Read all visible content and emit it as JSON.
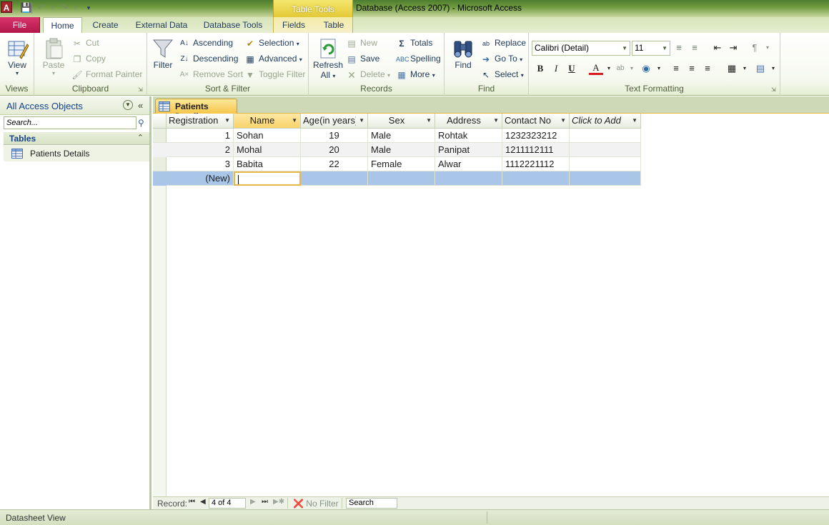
{
  "window": {
    "title": "Database1 : Database (Access 2007)  -  Microsoft Access",
    "contextual_header": "Table Tools"
  },
  "tabs": {
    "file": "File",
    "home": "Home",
    "create": "Create",
    "external_data": "External Data",
    "database_tools": "Database Tools",
    "fields": "Fields",
    "table": "Table"
  },
  "ribbon": {
    "views": {
      "label": "Views",
      "view": "View"
    },
    "clipboard": {
      "label": "Clipboard",
      "paste": "Paste",
      "cut": "Cut",
      "copy": "Copy",
      "format_painter": "Format Painter"
    },
    "sort_filter": {
      "label": "Sort & Filter",
      "filter": "Filter",
      "ascending": "Ascending",
      "descending": "Descending",
      "remove_sort": "Remove Sort",
      "selection": "Selection",
      "advanced": "Advanced",
      "toggle_filter": "Toggle Filter"
    },
    "records": {
      "label": "Records",
      "refresh": "Refresh",
      "refresh_all": "All",
      "new": "New",
      "save": "Save",
      "delete": "Delete",
      "totals": "Totals",
      "spelling": "Spelling",
      "more": "More"
    },
    "find": {
      "label": "Find",
      "find": "Find",
      "replace": "Replace",
      "goto": "Go To",
      "select": "Select"
    },
    "text_formatting": {
      "label": "Text Formatting",
      "font": "Calibri (Detail)",
      "size": "11",
      "bold": "B",
      "italic": "I",
      "underline": "U"
    }
  },
  "nav": {
    "title": "All Access Objects",
    "search_placeholder": "Search...",
    "group": "Tables",
    "items": [
      {
        "label": "Patients Details"
      }
    ]
  },
  "document": {
    "tab": "Patients Details"
  },
  "table": {
    "columns": [
      "Registration",
      "Name",
      "Age(in years)",
      "Sex",
      "Address",
      "Contact No",
      "Click to Add"
    ],
    "rows": [
      {
        "registration": "1",
        "name": "Sohan",
        "age": "19",
        "sex": "Male",
        "address": "Rohtak",
        "contact": "1232323212"
      },
      {
        "registration": "2",
        "name": "Mohal",
        "age": "20",
        "sex": "Male",
        "address": "Panipat",
        "contact": "1211112111"
      },
      {
        "registration": "3",
        "name": "Babita",
        "age": "22",
        "sex": "Female",
        "address": "Alwar",
        "contact": "1112221112"
      }
    ],
    "new_row_label": "(New)",
    "new_row_marker": "✳"
  },
  "record_nav": {
    "label": "Record:",
    "position": "4 of 4",
    "no_filter": "No Filter",
    "search": "Search"
  },
  "status": {
    "view": "Datasheet View"
  }
}
